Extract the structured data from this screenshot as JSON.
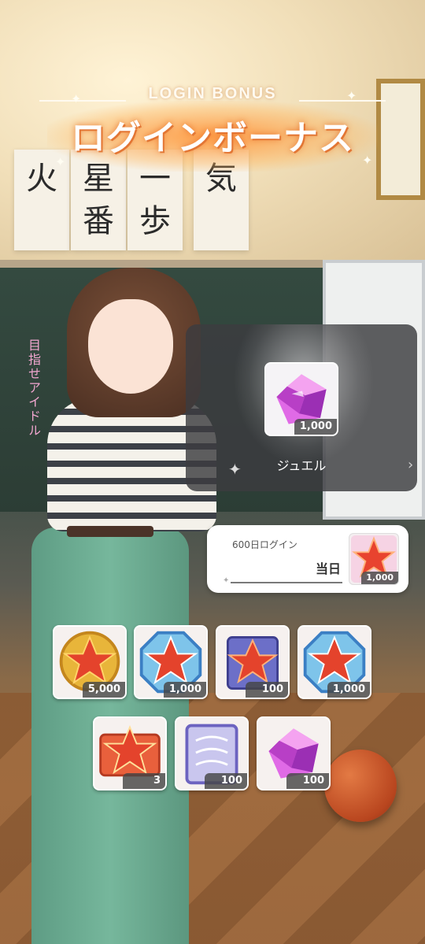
{
  "title": {
    "sub": "LOGIN BONUS",
    "main": "ログインボーナス"
  },
  "background": {
    "calligraphy": [
      "火",
      "星番",
      "一歩",
      "気"
    ],
    "chalk": "目指せアイドル"
  },
  "featured": {
    "item_icon": "jewel-icon",
    "count": "1,000",
    "label": "ジュエル"
  },
  "login_day": {
    "count_label": "600日ログイン",
    "status": "当日",
    "item_icon": "star-piece-icon",
    "item_count": "1,000"
  },
  "rewards": [
    {
      "icon": "gold-star-medal-icon",
      "count": "5,000"
    },
    {
      "icon": "blue-star-octagon-icon",
      "count": "1,000"
    },
    {
      "icon": "star-book-icon",
      "count": "100"
    },
    {
      "icon": "blue-star-octagon-icon",
      "count": "1,000"
    },
    {
      "icon": "star-ticket-icon",
      "count": "3"
    },
    {
      "icon": "lavender-ticket-icon",
      "count": "100"
    },
    {
      "icon": "jewel-icon",
      "count": "100"
    }
  ],
  "colors": {
    "title_glow": "#ff9a3c",
    "panel_bg": "#3c3c40",
    "count_badge": "#464646",
    "jewel": "#d14bd6"
  }
}
